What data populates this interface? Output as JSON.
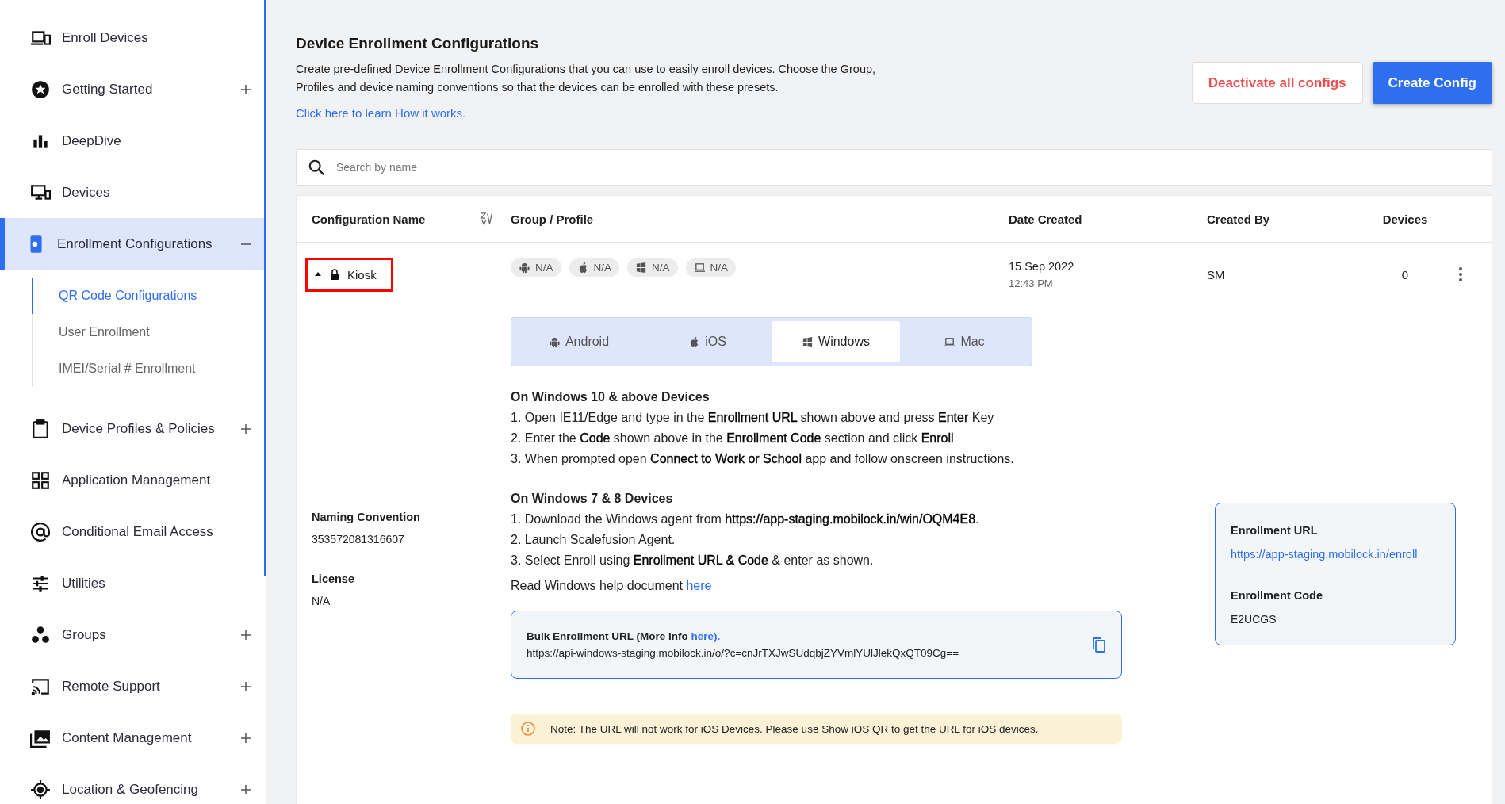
{
  "sidebar": {
    "items": [
      {
        "label": "Enroll Devices",
        "kind": "devices",
        "selected": false
      },
      {
        "label": "Getting Started",
        "kind": "star",
        "expanded": false,
        "selected": false
      },
      {
        "label": "DeepDive",
        "kind": "bars",
        "selected": false
      },
      {
        "label": "Devices",
        "kind": "monitor",
        "selected": false
      },
      {
        "label": "Enrollment Configurations",
        "kind": "phone",
        "expanded": true,
        "selected": true,
        "children": [
          {
            "label": "QR Code Configurations",
            "selected": true
          },
          {
            "label": "User Enrollment",
            "selected": false
          },
          {
            "label": "IMEI/Serial # Enrollment",
            "selected": false
          }
        ]
      },
      {
        "label": "Device Profiles & Policies",
        "kind": "clipboard",
        "expanded": false,
        "selected": false
      },
      {
        "label": "Application Management",
        "kind": "grid",
        "selected": false
      },
      {
        "label": "Conditional Email Access",
        "kind": "at",
        "selected": false
      },
      {
        "label": "Utilities",
        "kind": "sliders",
        "selected": false
      },
      {
        "label": "Groups",
        "kind": "dots",
        "expanded": false,
        "selected": false
      },
      {
        "label": "Remote Support",
        "kind": "cast",
        "expanded": false,
        "selected": false
      },
      {
        "label": "Content Management",
        "kind": "images",
        "expanded": false,
        "selected": false
      },
      {
        "label": "Location & Geofencing",
        "kind": "target",
        "expanded": false,
        "selected": false
      }
    ]
  },
  "header": {
    "title": "Device Enrollment Configurations",
    "description": "Create pre-defined Device Enrollment Configurations that you can use to easily enroll devices. Choose the Group, Profiles and device naming conventions so that the devices can be enrolled with these presets.",
    "learn_link": "Click here to learn How it works.",
    "buttons": [
      {
        "label": "Deactivate all configs",
        "kind": "secondary"
      },
      {
        "label": "Create Config",
        "kind": "primary"
      }
    ]
  },
  "search": {
    "placeholder": "Search by name"
  },
  "table": {
    "columns": [
      "Configuration Name",
      "Group / Profile",
      "Date Created",
      "Created By",
      "Devices"
    ],
    "rows": [
      {
        "name": "Kiosk",
        "locked": true,
        "expanded": true,
        "highlighted": true,
        "profiles": [
          {
            "kind": "android",
            "label": "N/A"
          },
          {
            "kind": "apple",
            "label": "N/A"
          },
          {
            "kind": "windows",
            "label": "N/A"
          },
          {
            "kind": "mac",
            "label": "N/A"
          }
        ],
        "date": "15 Sep 2022",
        "time": "12:43 PM",
        "created_by": "SM",
        "devices": "0",
        "details": {
          "tabs": [
            {
              "label": "Android",
              "kind": "android",
              "selected": false
            },
            {
              "label": "iOS",
              "kind": "apple",
              "selected": false
            },
            {
              "label": "Windows",
              "kind": "windows",
              "selected": true
            },
            {
              "label": "Mac",
              "kind": "mac",
              "selected": false
            }
          ],
          "sections": [
            {
              "heading": "On Windows 10 & above Devices",
              "steps": [
                "1. Open IE11/Edge and type in the **Enrollment URL** shown above and press **Enter** Key",
                "2. Enter the **Code** shown above in the **Enrollment Code** section and click **Enroll**",
                "3. When prompted open **Connect to Work or School** app and follow onscreen instructions."
              ]
            },
            {
              "heading": "On Windows 7 & 8 Devices",
              "steps": [
                "1. Download the Windows agent from **https://app-staging.mobilock.in/win/OQM4E8**.",
                "2. Launch Scalefusion Agent.",
                "3. Select Enroll using **Enrollment URL & Code** & enter as shown."
              ]
            }
          ],
          "help_text": "Read Windows help document",
          "help_link": "here",
          "bulk": {
            "label": "Bulk Enrollment URL (More Info",
            "link": "here).",
            "url": "https://api-windows-staging.mobilock.in/o/?c=cnJrTXJwSUdqbjZYVmlYUlJlekQxQT09Cg=="
          },
          "note": "Note: The URL will not work for iOS Devices. Please use Show iOS QR to get the URL for iOS devices.",
          "meta": [
            {
              "label": "Naming Convention",
              "value": "353572081316607"
            },
            {
              "label": "License",
              "value": "N/A"
            }
          ],
          "enrollment": [
            {
              "label": "Enrollment URL",
              "value": "https://app-staging.mobilock.in/enroll",
              "kind": "link"
            },
            {
              "label": "Enrollment Code",
              "value": "E2UCGS",
              "kind": "text"
            }
          ]
        }
      }
    ]
  }
}
